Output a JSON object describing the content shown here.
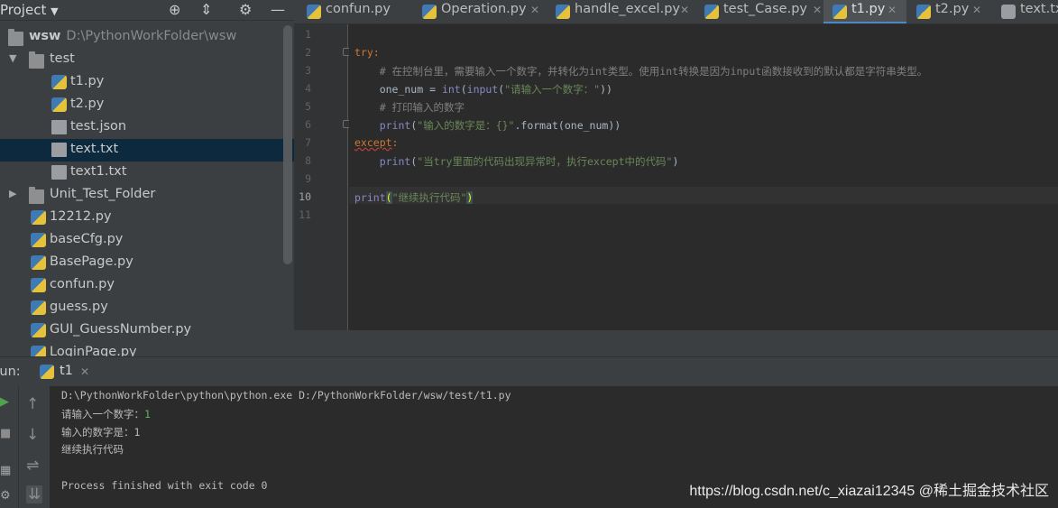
{
  "project": {
    "title": "Project",
    "root_name": "wsw",
    "root_path": "D:\\PythonWorkFolder\\wsw",
    "tree": [
      {
        "label": "test",
        "kind": "folder",
        "expanded": true,
        "depth": 1
      },
      {
        "label": "t1.py",
        "kind": "py",
        "depth": 2
      },
      {
        "label": "t2.py",
        "kind": "py",
        "depth": 2
      },
      {
        "label": "test.json",
        "kind": "json",
        "depth": 2
      },
      {
        "label": "text.txt",
        "kind": "txt",
        "depth": 2,
        "selected": true
      },
      {
        "label": "text1.txt",
        "kind": "txt",
        "depth": 2
      },
      {
        "label": "Unit_Test_Folder",
        "kind": "folder",
        "expanded": false,
        "depth": 1
      },
      {
        "label": "12212.py",
        "kind": "py",
        "depth": 1
      },
      {
        "label": "baseCfg.py",
        "kind": "py",
        "depth": 1
      },
      {
        "label": "BasePage.py",
        "kind": "py",
        "depth": 1
      },
      {
        "label": "confun.py",
        "kind": "py",
        "depth": 1
      },
      {
        "label": "guess.py",
        "kind": "py",
        "depth": 1
      },
      {
        "label": "GUI_GuessNumber.py",
        "kind": "py",
        "depth": 1
      },
      {
        "label": "LoginPage.py",
        "kind": "py",
        "depth": 1
      }
    ]
  },
  "tabs": [
    {
      "label": "confun.py",
      "active": false
    },
    {
      "label": "Operation.py",
      "active": false
    },
    {
      "label": "handle_excel.py",
      "active": false
    },
    {
      "label": "test_Case.py",
      "active": false
    },
    {
      "label": "t1.py",
      "active": true
    },
    {
      "label": "t2.py",
      "active": false
    },
    {
      "label": "text.txt",
      "active": false
    }
  ],
  "editor": {
    "line_numbers": [
      "1",
      "2",
      "3",
      "4",
      "5",
      "6",
      "7",
      "8",
      "9",
      "10",
      "11"
    ],
    "current_line": "10",
    "lines": {
      "l2_kw": "try",
      "l2_p": ":",
      "l3": "    # 在控制台里，需要输入一个数字，并转化为int类型。使用int转换是因为input函数接收到的默认都是字符串类型。",
      "l4_a": "    one_num = ",
      "l4_b": "int",
      "l4_c": "(",
      "l4_d": "input",
      "l4_e": "(",
      "l4_f": "\"请输入一个数字：\"",
      "l4_g": "))",
      "l5": "    # 打印输入的数字",
      "l6_a": "    ",
      "l6_b": "print",
      "l6_c": "(",
      "l6_d": "\"输入的数字是：{}\"",
      "l6_e": ".format(one_num))",
      "l7_kw": "except",
      "l7_p": ":",
      "l8_a": "    ",
      "l8_b": "print",
      "l8_c": "(",
      "l8_d": "\"当try里面的代码出现异常时，执行except中的代码\"",
      "l8_e": ")",
      "l10_a": "print",
      "l10_b": "(",
      "l10_c": "\"继续执行代码\"",
      "l10_d": ")"
    }
  },
  "run": {
    "label": "Run:",
    "tab_label": "t1",
    "output": {
      "cmd": "D:\\PythonWorkFolder\\python\\python.exe D:/PythonWorkFolder/wsw/test/t1.py",
      "prompt": "请输入一个数字：",
      "typed": "1",
      "result": "输入的数字是：1",
      "continue": "继续执行代码",
      "finished": "Process finished with exit code 0"
    }
  },
  "watermark": "https://blog.csdn.net/c_xiazai12345 @稀土掘金技术社区"
}
